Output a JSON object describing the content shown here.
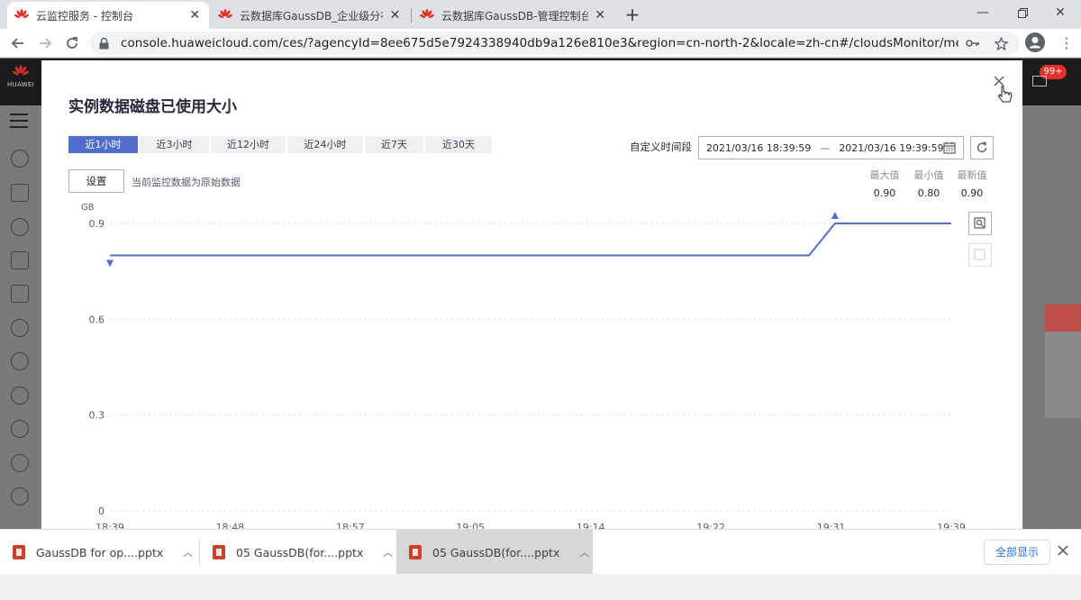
{
  "browser": {
    "tabs": [
      {
        "label": "云监控服务 - 控制台",
        "active": true
      },
      {
        "label": "云数据库GaussDB_企业级分布式",
        "active": false
      },
      {
        "label": "云数据库GaussDB-管理控制台",
        "active": false
      }
    ],
    "url": "console.huaweicloud.com/ces/?agencyId=8ee675d5e7924338940db9a126e810e3&region=cn-north-2&locale=zh-cn#/cloudsMonitor/metrics?na..."
  },
  "app": {
    "logo_text": "HUAWEI",
    "notification_count": "99+"
  },
  "modal": {
    "title": "实例数据磁盘已使用大小",
    "time_presets": [
      "近1小时",
      "近3小时",
      "近12小时",
      "近24小时",
      "近7天",
      "近30天"
    ],
    "active_preset": 0,
    "custom_label": "自定义时间段",
    "date_start": "2021/03/16 18:39:59",
    "date_sep": "—",
    "date_end": "2021/03/16 19:39:59",
    "setting_button": "设置",
    "raw_data_note": "当前监控数据为原始数据",
    "stats": [
      {
        "label": "最大值",
        "value": "0.90"
      },
      {
        "label": "最小值",
        "value": "0.80"
      },
      {
        "label": "最新值",
        "value": "0.90"
      }
    ]
  },
  "chart_data": {
    "type": "line",
    "unit": "GB",
    "y_ticks": [
      "0.9",
      "0.6",
      "0.3",
      "0"
    ],
    "ylim": [
      0,
      0.9
    ],
    "x_tick_labels": [
      "18:39",
      "18:48",
      "18:57",
      "19:05",
      "19:14",
      "19:22",
      "19:31",
      "19:39"
    ],
    "series": [
      {
        "x_minutes": [
          0,
          56.5,
          58.6,
          68
        ],
        "values": [
          0.8,
          0.8,
          0.9,
          0.9
        ]
      }
    ],
    "min_marker": {
      "x_minutes": 0,
      "value": 0.8
    },
    "max_marker": {
      "x_minutes": 58.6,
      "value": 0.9
    },
    "line_color": "#526ecc",
    "grid": "dashed horizontal"
  },
  "downloads": [
    {
      "label": "GaussDB for op....pptx"
    },
    {
      "label": "05 GaussDB(for....pptx"
    },
    {
      "label": "05 GaussDB(for....pptx"
    }
  ],
  "downloads_show_all": "全部显示"
}
